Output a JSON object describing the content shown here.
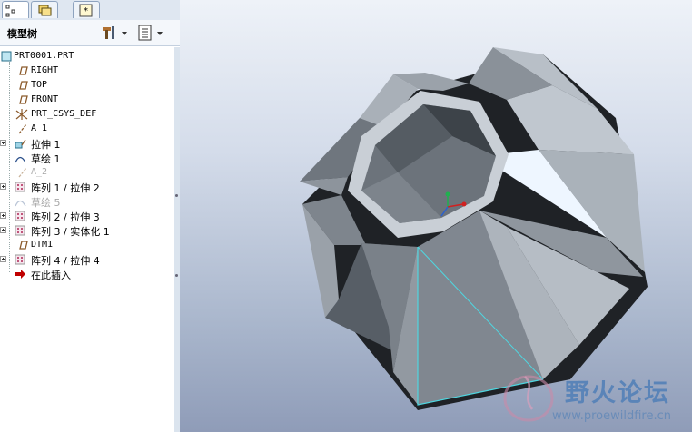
{
  "panel": {
    "title": "模型树",
    "tabs": [
      "model-tree-tab",
      "layers-tab",
      "favorites-tab"
    ]
  },
  "tree": {
    "root": "PRT0001.PRT",
    "items": [
      {
        "label": "RIGHT",
        "icon": "datum-plane-icon",
        "state": "normal"
      },
      {
        "label": "TOP",
        "icon": "datum-plane-icon",
        "state": "normal"
      },
      {
        "label": "FRONT",
        "icon": "datum-plane-icon",
        "state": "normal"
      },
      {
        "label": "PRT_CSYS_DEF",
        "icon": "csys-icon",
        "state": "normal"
      },
      {
        "label": "A_1",
        "icon": "datum-axis-icon",
        "state": "normal"
      },
      {
        "label": "拉伸 1",
        "icon": "extrude-icon",
        "state": "normal",
        "expandable": true
      },
      {
        "label": "草绘 1",
        "icon": "sketch-icon",
        "state": "normal"
      },
      {
        "label": "A_2",
        "icon": "datum-axis-icon",
        "state": "suppressed"
      },
      {
        "label": "阵列 1 / 拉伸 2",
        "icon": "pattern-icon",
        "state": "normal",
        "expandable": true
      },
      {
        "label": "草绘 5",
        "icon": "sketch-icon",
        "state": "suppressed"
      },
      {
        "label": "阵列 2 / 拉伸 3",
        "icon": "pattern-icon",
        "state": "normal",
        "expandable": true
      },
      {
        "label": "阵列 3 / 实体化 1",
        "icon": "pattern-icon",
        "state": "normal",
        "expandable": true
      },
      {
        "label": "DTM1",
        "icon": "datum-plane-icon",
        "state": "normal"
      },
      {
        "label": "阵列 4 / 拉伸 4",
        "icon": "pattern-icon",
        "state": "normal",
        "expandable": true
      },
      {
        "label": "在此插入",
        "icon": "insert-here-arrow-icon",
        "state": "normal"
      }
    ]
  },
  "watermark": {
    "title": "野火论坛",
    "url": "www.proewildfire.cn"
  },
  "colors": {
    "accent": "#5a84b8",
    "datum": "#8b5a2b",
    "pattern": "#c0557a",
    "insert_arrow": "#c00000",
    "selection_edge": "#4fd6e0"
  }
}
